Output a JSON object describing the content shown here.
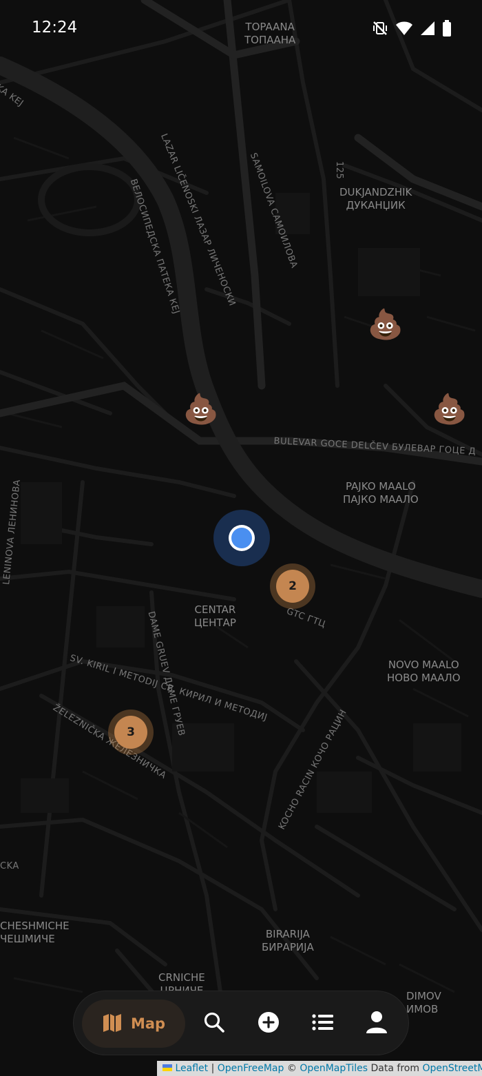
{
  "status_bar": {
    "time": "12:24",
    "icons": [
      "vibrate-off-icon",
      "wifi-icon",
      "signal-icon",
      "battery-icon"
    ]
  },
  "map": {
    "theme": "dark",
    "place_labels": [
      {
        "latin": "TOPAANA",
        "cyrillic": "ТОПААНА"
      },
      {
        "latin": "DUKJANDZHIK",
        "cyrillic": "ДУКАНЏИК"
      },
      {
        "latin": "PAJKO MAALO",
        "cyrillic": "ПАЈКО МААЛО"
      },
      {
        "latin": "CENTAR",
        "cyrillic": "ЦЕНТАР"
      },
      {
        "latin": "NOVO MAALO",
        "cyrillic": "НОВО МААЛО"
      },
      {
        "latin": "BIRARIJA",
        "cyrillic": "БИРАРИЈА"
      },
      {
        "latin": "CHESHMICHE",
        "cyrillic": "ЧЕШМИЧЕ"
      },
      {
        "latin": "CRNICHE",
        "cyrillic": "ЦРНИЧЕ"
      },
      {
        "latin": "DIMOV",
        "cyrillic": "ИМОВ"
      }
    ],
    "street_labels": [
      "KA KEJ",
      "LAZAR LIČENOSKI ЛАЗАР ЛИЧЕНОСКИ",
      "SAMOILOVA САМОИЛОВА",
      "ВЕЛОСИПЕДСКА ПАТЕКА КЕЈ",
      "125",
      "BULEVAR GOCE DELČEV БУЛЕВАР ГОЦЕ Д",
      "LENINOVA ЛЕНИНОВА",
      "GTC ГТЦ",
      "DAME GRUEV ДАМЕ ГРУЕВ",
      "SV. KIRIL I METODIJ СВ. КИРИЛ И МЕТОДИЈ",
      "ŽELEZNIČKA ЖЕЛЕЗНИЧКА",
      "KOCHO RACIN КОЧО РАЦИН",
      "CKA"
    ],
    "markers": [
      {
        "type": "poop",
        "icon": "poop-emoji-icon"
      },
      {
        "type": "poop",
        "icon": "poop-emoji-icon"
      },
      {
        "type": "poop",
        "icon": "poop-emoji-icon"
      }
    ],
    "clusters": [
      {
        "count": "2"
      },
      {
        "count": "3"
      }
    ],
    "user_location_color": "#4a8ff0",
    "marker_color": "#c48651"
  },
  "nav": {
    "map_label": "Map",
    "items": [
      "map-icon",
      "search-icon",
      "add-icon",
      "list-icon",
      "profile-icon"
    ],
    "accent": "#d08e52"
  },
  "attribution": {
    "leaflet": "Leaflet",
    "sep1": "|",
    "openfreemap": "OpenFreeMap",
    "copy": "©",
    "openmaptiles": "OpenMapTiles",
    "data_from": "Data from",
    "osm": "OpenStreetMap"
  }
}
